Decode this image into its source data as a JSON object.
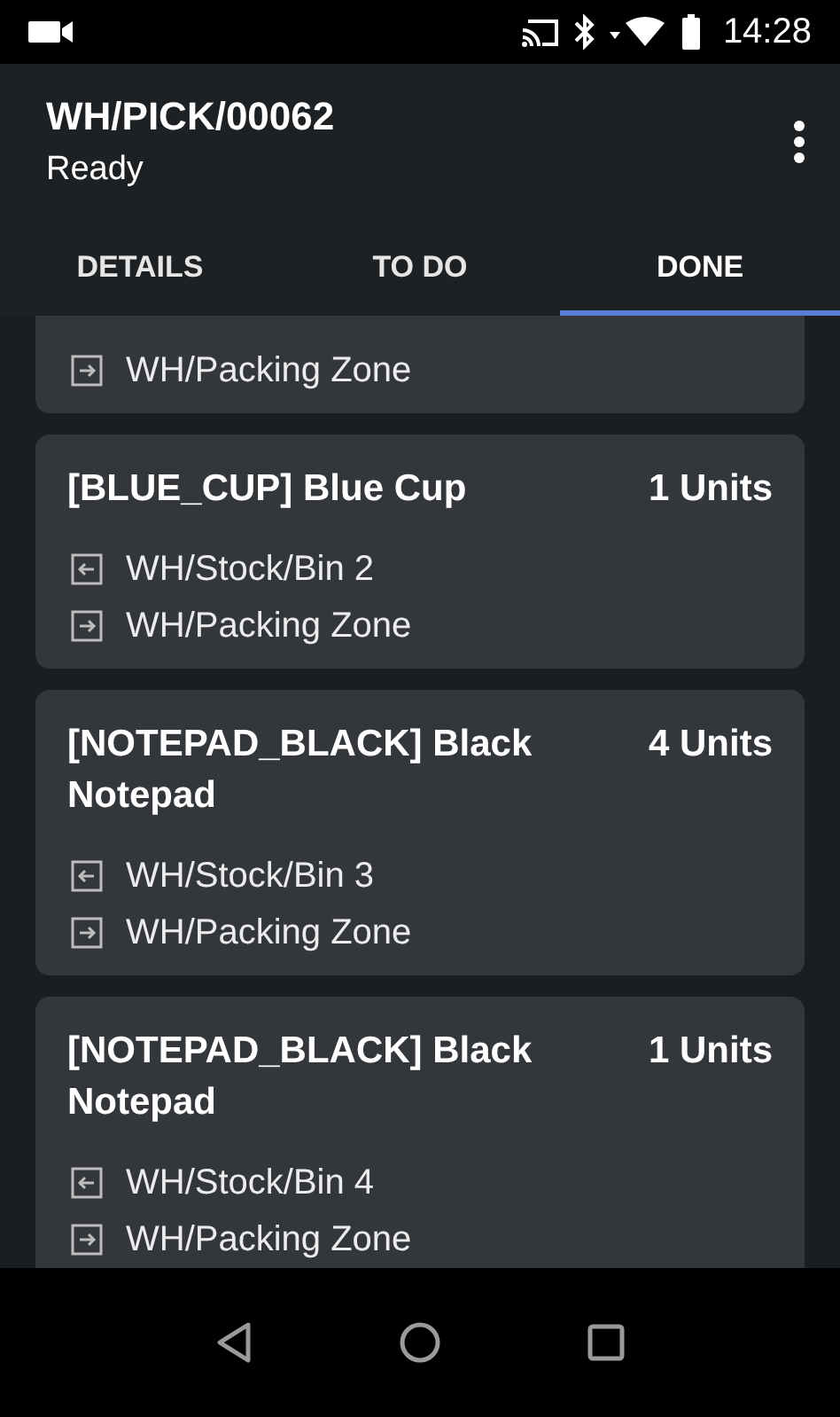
{
  "status_bar": {
    "time": "14:28"
  },
  "app_bar": {
    "title": "WH/PICK/00062",
    "subtitle": "Ready"
  },
  "tabs": [
    {
      "label": "DETAILS",
      "selected": false
    },
    {
      "label": "TO DO",
      "selected": false
    },
    {
      "label": "DONE",
      "selected": true
    }
  ],
  "moves": [
    {
      "destination": "WH/Packing Zone"
    },
    {
      "product": "[BLUE_CUP] Blue Cup",
      "quantity": "1 Units",
      "source": "WH/Stock/Bin 2",
      "destination": "WH/Packing Zone"
    },
    {
      "product": "[NOTEPAD_BLACK] Black Notepad",
      "quantity": "4 Units",
      "source": "WH/Stock/Bin 3",
      "destination": "WH/Packing Zone"
    },
    {
      "product": "[NOTEPAD_BLACK] Black Notepad",
      "quantity": "1 Units",
      "source": "WH/Stock/Bin 4",
      "destination": "WH/Packing Zone"
    }
  ]
}
